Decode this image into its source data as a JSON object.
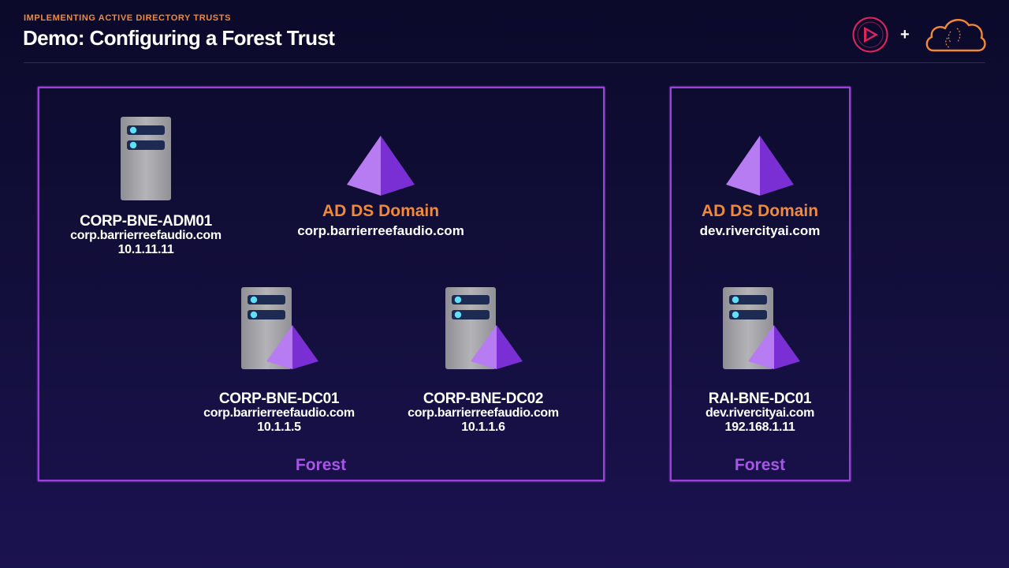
{
  "header": {
    "kicker": "IMPLEMENTING ACTIVE DIRECTORY TRUSTS",
    "title": "Demo: Configuring a Forest Trust",
    "plus": "+"
  },
  "colors": {
    "accent_orange": "#f08a3a",
    "forest_border": "#a23ee0",
    "forest_label": "#a855e8",
    "pyramid_light": "#b77cf2",
    "pyramid_dark": "#7a2fd4"
  },
  "forests": [
    {
      "label": "Forest",
      "domain": {
        "title": "AD DS Domain",
        "name": "corp.barrierreefaudio.com"
      },
      "servers": [
        {
          "name": "CORP-BNE-ADM01",
          "domain": "corp.barrierreefaudio.com",
          "ip": "10.1.11.11",
          "icon": "server-icon"
        },
        {
          "name": "CORP-BNE-DC01",
          "domain": "corp.barrierreefaudio.com",
          "ip": "10.1.1.5",
          "icon": "domain-controller-icon"
        },
        {
          "name": "CORP-BNE-DC02",
          "domain": "corp.barrierreefaudio.com",
          "ip": "10.1.1.6",
          "icon": "domain-controller-icon"
        }
      ]
    },
    {
      "label": "Forest",
      "domain": {
        "title": "AD DS Domain",
        "name": "dev.rivercityai.com"
      },
      "servers": [
        {
          "name": "RAI-BNE-DC01",
          "domain": "dev.rivercityai.com",
          "ip": "192.168.1.11",
          "icon": "domain-controller-icon"
        }
      ]
    }
  ]
}
